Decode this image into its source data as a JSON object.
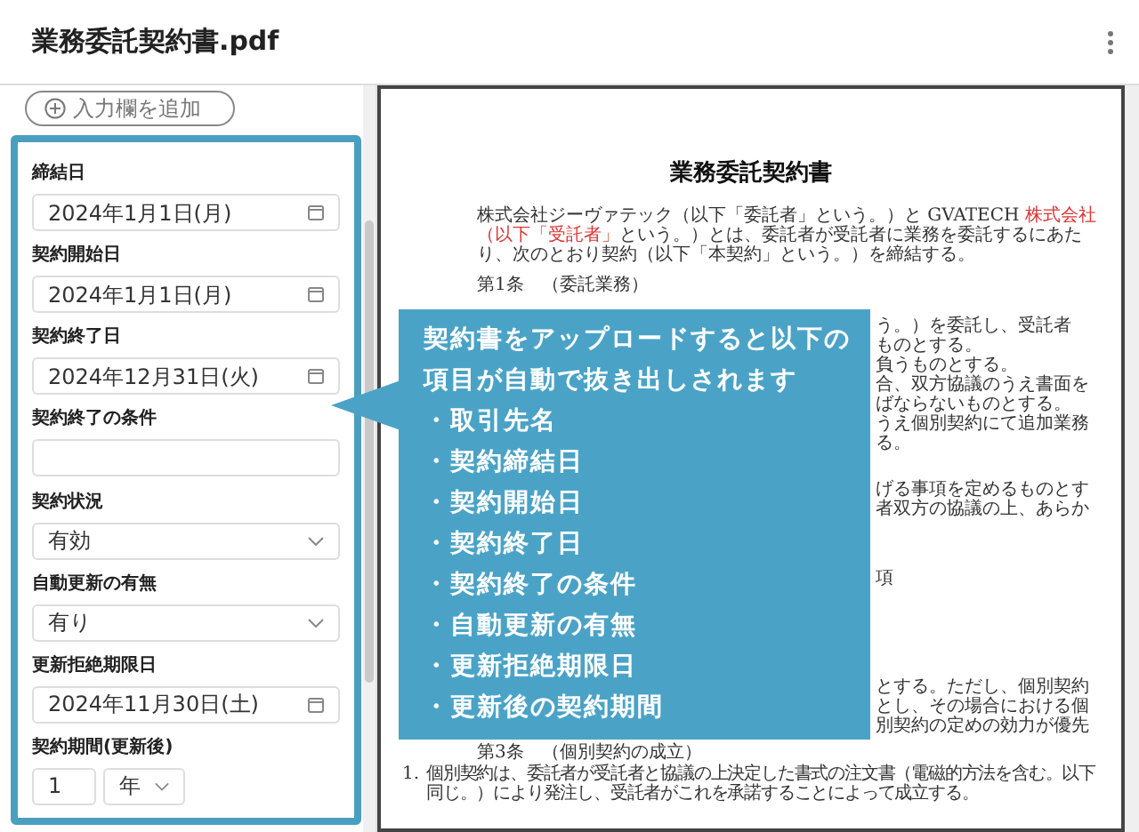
{
  "window": {
    "title": "業務委託契約書.pdf"
  },
  "add_field_button": {
    "label": "入力欄を追加"
  },
  "form": {
    "fields": [
      {
        "kind": "date",
        "label": "締結日",
        "value": "2024年1月1日(月)"
      },
      {
        "kind": "date",
        "label": "契約開始日",
        "value": "2024年1月1日(月)"
      },
      {
        "kind": "date",
        "label": "契約終了日",
        "value": "2024年12月31日(火)"
      },
      {
        "kind": "text",
        "label": "契約終了の条件"
      },
      {
        "kind": "select",
        "label": "契約状況",
        "value": "有効"
      },
      {
        "kind": "select",
        "label": "自動更新の有無",
        "value": "有り"
      },
      {
        "kind": "date",
        "label": "更新拒絶期限日",
        "value": "2024年11月30日(土)"
      },
      {
        "kind": "period",
        "label": "契約期間(更新後)",
        "value": "1",
        "unit": "年"
      }
    ]
  },
  "document": {
    "title": "業務委託契約書",
    "intro": [
      {
        "text": "株式会社ジーヴァテック（以下「委託者」という。）と GVATECH ",
        "highlighted": false
      },
      {
        "text": "株式会社（以下「受託者」",
        "highlighted": true
      },
      {
        "text": "という。）とは、委託者が受託者に業務を委託するにあたり、次のとおり契約（以下「本契約」という。）を締結する。",
        "highlighted": false
      }
    ],
    "article_1_heading": "第1条　（委託業務）",
    "partly_covered_lines_1": [
      "う。）を委託し、受託者",
      "ものとする。",
      "負うものとする。",
      "合、双方協議のうえ書面を",
      "ばならないものとする。",
      "うえ個別契約にて追加業務",
      "る。"
    ],
    "partly_covered_lines_2": [
      "げる事項を定めるものとす",
      "者双方の協議の上、あらか"
    ],
    "partly_covered_lines_3": [
      "項"
    ],
    "partly_covered_lines_4": [
      "とする。ただし、個別契約",
      "とし、その場合における個",
      "別契約の定めの効力が優先"
    ],
    "article_3_heading": "第3条　（個別契約の成立）",
    "article_3_item": {
      "number": "1.",
      "text": "個別契約は、委託者が受託者と協議の上決定した書式の注文書（電磁的方法を含む。以下同じ。）により発注し、受託者がこれを承諾することによって成立する。"
    }
  },
  "callout": {
    "heading": "契約書をアップロードすると以下の項目が自動で抜き出しされます",
    "items": [
      "・取引先名",
      "・契約締結日",
      "・契約開始日",
      "・契約終了日",
      "・契約終了の条件",
      "・自動更新の有無",
      "・更新拒絶期限日",
      "・更新後の契約期間"
    ]
  }
}
